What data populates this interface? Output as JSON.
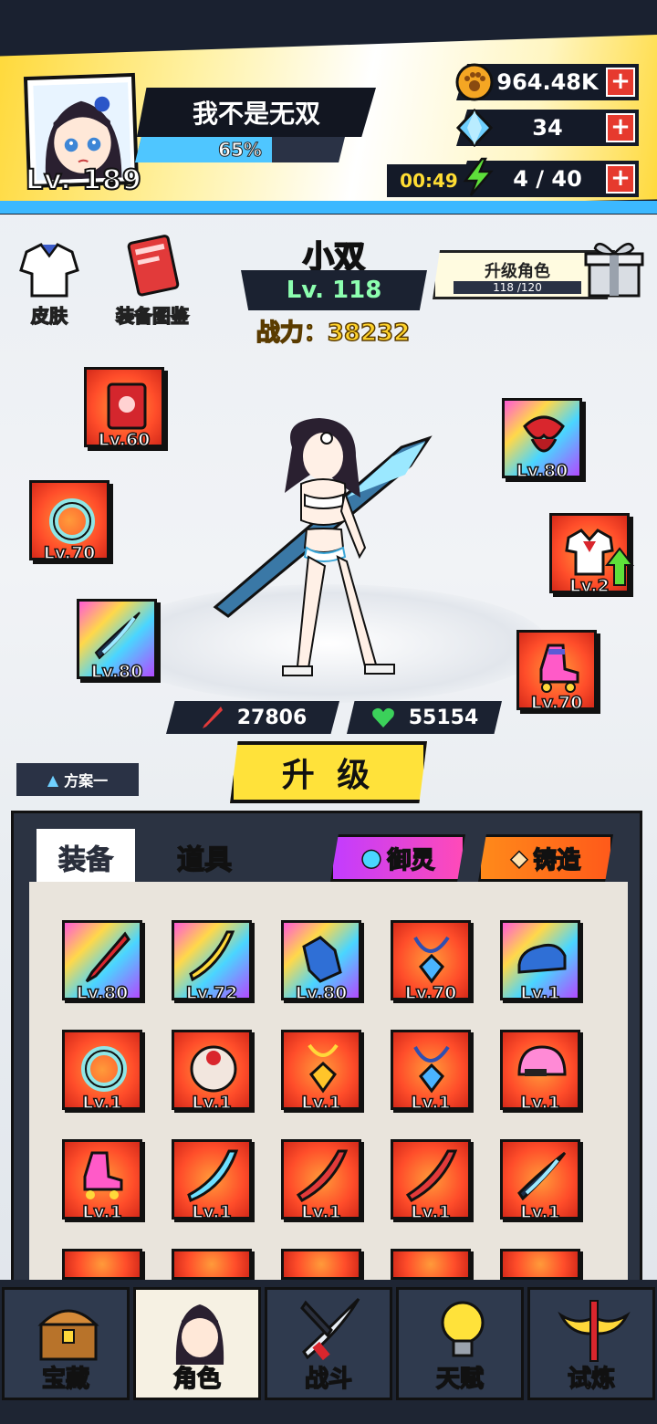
{
  "player": {
    "name": "我不是无双",
    "level": "Lv. 189",
    "exp_percent_label": "65%",
    "exp_fraction": 0.65
  },
  "resources": {
    "coins": "964.48K",
    "gems": "34",
    "energy": "4 / 40",
    "energy_timer": "00:49"
  },
  "quick_buttons": {
    "skin": "皮肤",
    "codex": "装备图鉴"
  },
  "hero": {
    "name": "小双",
    "level": "Lv. 118",
    "power_label": "战力：",
    "power": "38232",
    "attack": "27806",
    "hp": "55154"
  },
  "upgrade_role": {
    "label": "升级角色",
    "progress": "118 /120"
  },
  "equipped": {
    "left_top": "Lv.60",
    "left_mid": "Lv.70",
    "left_bottom": "Lv.80",
    "right_top": "Lv.80",
    "right_mid": "Lv.2",
    "right_bottom": "Lv.70"
  },
  "upgrade_button": "升 级",
  "scheme": "方案一",
  "tabs": {
    "equipment": "装备",
    "items": "道具",
    "spirit": "御灵",
    "forge": "铸造"
  },
  "inventory": [
    {
      "lv": "Lv.80",
      "icon": "red-sword-icon",
      "bg": "rainbow"
    },
    {
      "lv": "Lv.72",
      "icon": "banana-sword-icon",
      "bg": "rainbow"
    },
    {
      "lv": "Lv.80",
      "icon": "blue-gloves-icon",
      "bg": "rainbow"
    },
    {
      "lv": "Lv.70",
      "icon": "blue-gem-necklace-icon",
      "bg": "red"
    },
    {
      "lv": "Lv.1",
      "icon": "blue-shoe-icon",
      "bg": "rainbow"
    },
    {
      "lv": "Lv.1",
      "icon": "jade-ring-icon",
      "bg": "red"
    },
    {
      "lv": "Lv.1",
      "icon": "orb-ring-icon",
      "bg": "red"
    },
    {
      "lv": "Lv.1",
      "icon": "gold-pendant-icon",
      "bg": "red"
    },
    {
      "lv": "Lv.1",
      "icon": "blue-gem-necklace-icon",
      "bg": "red"
    },
    {
      "lv": "Lv.1",
      "icon": "pink-helmet-icon",
      "bg": "red"
    },
    {
      "lv": "Lv.1",
      "icon": "roller-skate-icon",
      "bg": "red"
    },
    {
      "lv": "Lv.1",
      "icon": "scimitar-icon",
      "bg": "red"
    },
    {
      "lv": "Lv.1",
      "icon": "red-blade-icon",
      "bg": "red"
    },
    {
      "lv": "Lv.1",
      "icon": "red-blade-icon",
      "bg": "red"
    },
    {
      "lv": "Lv.1",
      "icon": "dark-blade-icon",
      "bg": "red"
    }
  ],
  "nav": {
    "treasure": "宝藏",
    "character": "角色",
    "battle": "战斗",
    "talent": "天赋",
    "trial": "试炼"
  },
  "colors": {
    "accent_yellow": "#ffe23a",
    "panel_dark": "#2b3342",
    "exp_blue": "#4fc6ff",
    "plus_red": "#e63a2e",
    "hp_green": "#3bd15a"
  }
}
